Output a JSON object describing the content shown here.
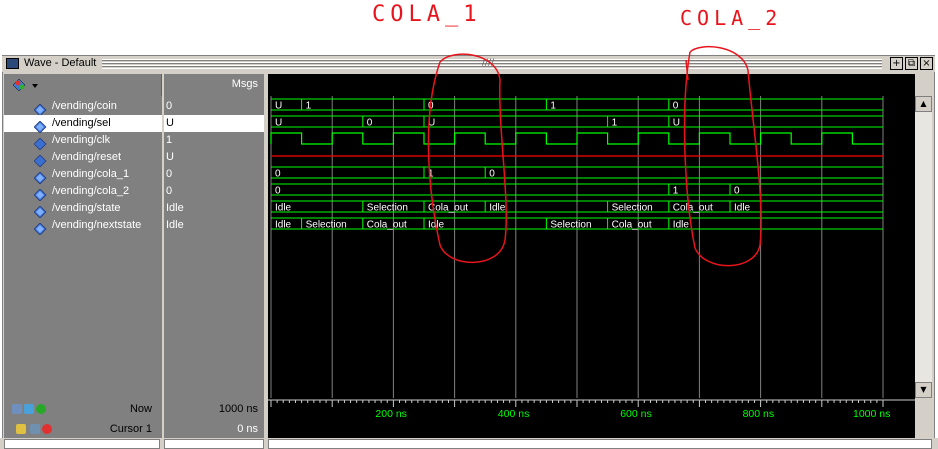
{
  "annotations": {
    "cola1": "COLA_1",
    "cola2": "COLA_2"
  },
  "window": {
    "title": "Wave - Default"
  },
  "header": {
    "msgs": "Msgs"
  },
  "signals": [
    {
      "name": "/vending/coin",
      "value": "0",
      "icon": "bus-signal-icon"
    },
    {
      "name": "/vending/sel",
      "value": "U",
      "icon": "bus-signal-icon",
      "selected": true
    },
    {
      "name": "/vending/clk",
      "value": "1",
      "icon": "bit-signal-icon"
    },
    {
      "name": "/vending/reset",
      "value": "U",
      "icon": "bit-signal-icon"
    },
    {
      "name": "/vending/cola_1",
      "value": "0",
      "icon": "bus-signal-icon"
    },
    {
      "name": "/vending/cola_2",
      "value": "0",
      "icon": "bus-signal-icon"
    },
    {
      "name": "/vending/state",
      "value": "Idle",
      "icon": "bus-signal-icon"
    },
    {
      "name": "/vending/nextstate",
      "value": "Idle",
      "icon": "bus-signal-icon"
    }
  ],
  "footer": {
    "now_label": "Now",
    "now_value": "1000 ns",
    "cursor_label": "Cursor 1",
    "cursor_value": "0 ns"
  },
  "timeline": {
    "ticks": [
      "200 ns",
      "400 ns",
      "600 ns",
      "800 ns",
      "1000 ns"
    ]
  },
  "waves": {
    "coin": [
      "U",
      "1",
      "0",
      "1",
      "0"
    ],
    "sel": [
      "U",
      "0",
      "U",
      "1",
      "U"
    ],
    "cola_1": [
      "0",
      "1",
      "0"
    ],
    "cola_2": [
      "0",
      "1",
      "0"
    ],
    "state": [
      "Idle",
      "Selection",
      "Cola_out",
      "Idle",
      "Selection",
      "Cola_out",
      "Idle"
    ],
    "nextstate": [
      "Idle",
      "Selection",
      "Cola_out",
      "Idle",
      "Selection",
      "Cola_out",
      "Idle"
    ]
  },
  "colors": {
    "wave": "#00ff00",
    "reset": "#ff0000",
    "annotation": "#e8141c",
    "grid": "#808080"
  }
}
